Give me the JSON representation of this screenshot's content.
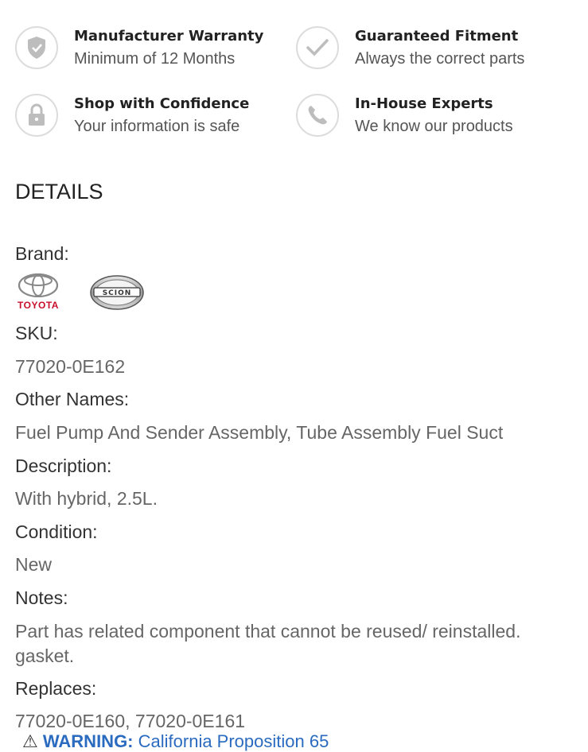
{
  "features": [
    {
      "title": "Manufacturer Warranty",
      "subtitle": "Minimum of 12 Months",
      "icon": "shield-icon"
    },
    {
      "title": "Guaranteed Fitment",
      "subtitle": "Always the correct parts",
      "icon": "checkmark-icon"
    },
    {
      "title": "Shop with Confidence",
      "subtitle": "Your information is safe",
      "icon": "lock-icon"
    },
    {
      "title": "In-House Experts",
      "subtitle": "We know our products",
      "icon": "phone-icon"
    }
  ],
  "details": {
    "heading": "DETAILS",
    "brand_label": "Brand:",
    "brands": [
      {
        "name": "TOYOTA",
        "color": "#c8102e"
      },
      {
        "name": "SCION"
      }
    ],
    "sku_label": "SKU:",
    "sku": "77020-0E162",
    "other_names_label": "Other Names:",
    "other_names": "Fuel Pump And Sender Assembly, Tube Assembly Fuel Suct",
    "description_label": "Description:",
    "description": "With hybrid, 2.5L.",
    "condition_label": "Condition:",
    "condition": "New",
    "notes_label": "Notes:",
    "notes": "Part has related component that cannot be reused/ reinstalled. gasket.",
    "replaces_label": "Replaces:",
    "replaces": "77020-0E160, 77020-0E161"
  },
  "warning": {
    "label": "WARNING:",
    "text": "California Proposition 65"
  }
}
